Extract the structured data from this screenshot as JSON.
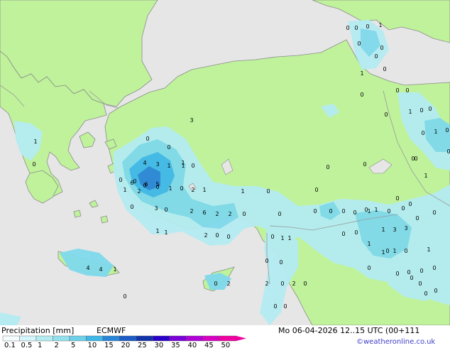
{
  "map": {
    "colors": {
      "sea": "#e6e6e6",
      "land": "#bff29b",
      "coast": "#8c8c8c",
      "border": "#9a9a9a",
      "precip_light": "#b4ecf2",
      "precip_mid": "#7fd9ec",
      "precip_heavy": "#3fb8e8",
      "precip_heavier": "#2a86d8"
    },
    "value_labels": [
      {
        "t": "0"
      },
      {
        "t": "0"
      },
      {
        "t": "0"
      },
      {
        "t": "1"
      },
      {
        "t": "0"
      },
      {
        "t": "0"
      },
      {
        "t": "0"
      },
      {
        "t": "0"
      },
      {
        "t": "1"
      },
      {
        "t": "0"
      },
      {
        "t": "0"
      },
      {
        "t": "0"
      },
      {
        "t": "1"
      },
      {
        "t": "0"
      },
      {
        "t": "0"
      },
      {
        "t": "0"
      },
      {
        "t": "1"
      },
      {
        "t": "0"
      },
      {
        "t": "0"
      },
      {
        "t": "0"
      },
      {
        "t": "1"
      },
      {
        "t": "0"
      },
      {
        "t": "3"
      },
      {
        "t": "1"
      },
      {
        "t": "0"
      },
      {
        "t": "0"
      },
      {
        "t": "0"
      },
      {
        "t": "1"
      },
      {
        "t": "0"
      },
      {
        "t": "0"
      },
      {
        "t": "0"
      },
      {
        "t": "0"
      },
      {
        "t": "4"
      },
      {
        "t": "3"
      },
      {
        "t": "1"
      },
      {
        "t": "1"
      },
      {
        "t": "0"
      },
      {
        "t": "0"
      },
      {
        "t": "0"
      },
      {
        "t": "0"
      },
      {
        "t": "6"
      },
      {
        "t": "6"
      },
      {
        "t": "5"
      },
      {
        "t": "1"
      },
      {
        "t": "0"
      },
      {
        "t": "2"
      },
      {
        "t": "1"
      },
      {
        "t": "1"
      },
      {
        "t": "0"
      },
      {
        "t": "0"
      },
      {
        "t": "0"
      },
      {
        "t": "3"
      },
      {
        "t": "0"
      },
      {
        "t": "2"
      },
      {
        "t": "6"
      },
      {
        "t": "2"
      },
      {
        "t": "2"
      },
      {
        "t": "0"
      },
      {
        "t": "0"
      },
      {
        "t": "1"
      },
      {
        "t": "1"
      },
      {
        "t": "2"
      },
      {
        "t": "0"
      },
      {
        "t": "0"
      },
      {
        "t": "0"
      },
      {
        "t": "1"
      },
      {
        "t": "1"
      },
      {
        "t": "0"
      },
      {
        "t": "0"
      },
      {
        "t": "0"
      },
      {
        "t": "0"
      },
      {
        "t": "0"
      },
      {
        "t": "1"
      },
      {
        "t": "0"
      },
      {
        "t": "1"
      },
      {
        "t": "3"
      },
      {
        "t": "3"
      },
      {
        "t": "0"
      },
      {
        "t": "0"
      },
      {
        "t": "1"
      },
      {
        "t": "1"
      },
      {
        "t": "1"
      },
      {
        "t": "0"
      },
      {
        "t": "1"
      },
      {
        "t": "0"
      },
      {
        "t": "0"
      },
      {
        "t": "0"
      },
      {
        "t": "0"
      },
      {
        "t": "0"
      },
      {
        "t": "0"
      },
      {
        "t": "0"
      },
      {
        "t": "2"
      },
      {
        "t": "0"
      },
      {
        "t": "2"
      },
      {
        "t": "0"
      },
      {
        "t": "0"
      },
      {
        "t": "0"
      },
      {
        "t": "4"
      },
      {
        "t": "4"
      },
      {
        "t": "1"
      },
      {
        "t": "0"
      },
      {
        "t": "0"
      },
      {
        "t": "2"
      },
      {
        "t": "1"
      },
      {
        "t": "2"
      },
      {
        "t": "0"
      },
      {
        "t": "0"
      },
      {
        "t": "0"
      },
      {
        "t": "0"
      },
      {
        "t": "0"
      },
      {
        "t": "0"
      },
      {
        "t": "0"
      },
      {
        "t": "1"
      },
      {
        "t": "0"
      },
      {
        "t": "0"
      },
      {
        "t": "0"
      }
    ]
  },
  "footer": {
    "title": "Precipitation [mm]",
    "model": "ECMWF",
    "datetime": "Mo 06-04-2026 12..15 UTC (00+111",
    "credit": "©weatheronline.co.uk",
    "scale_labels": [
      "0.1",
      "0.5",
      "1",
      "2",
      "5",
      "10",
      "15",
      "20",
      "25",
      "30",
      "35",
      "40",
      "45",
      "50"
    ],
    "scale_colors": [
      "#f5fdff",
      "#d4f5fb",
      "#b4ecf2",
      "#94e1ee",
      "#6fd0ea",
      "#3fb8e8",
      "#2a86d8",
      "#1c5cc4",
      "#1234a8",
      "#2a00c8",
      "#7a00d8",
      "#b000d8",
      "#d800c0",
      "#f000a0"
    ]
  }
}
